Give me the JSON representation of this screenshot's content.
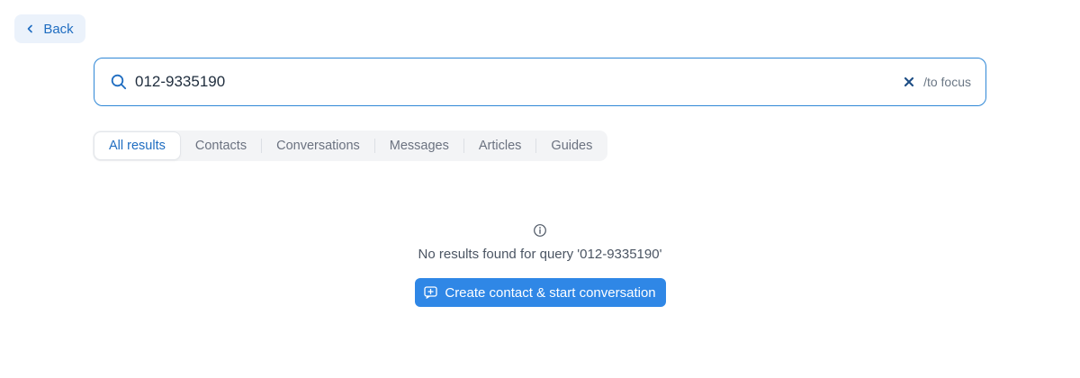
{
  "back": {
    "label": "Back"
  },
  "search": {
    "value": "012-9335190",
    "hint": "/to focus"
  },
  "tabs": [
    {
      "label": "All results",
      "active": true
    },
    {
      "label": "Contacts"
    },
    {
      "label": "Conversations"
    },
    {
      "label": "Messages"
    },
    {
      "label": "Articles"
    },
    {
      "label": "Guides"
    }
  ],
  "empty_state": {
    "message": "No results found for query '012-9335190'",
    "action_label": "Create contact & start conversation"
  },
  "icons": {
    "back": "chevron-left-icon",
    "search": "search-icon",
    "clear": "close-icon",
    "info": "info-icon",
    "create": "message-plus-icon"
  },
  "colors": {
    "accent": "#2f87e6",
    "link": "#1f6dc1",
    "back_bg": "#ebf2fb"
  }
}
